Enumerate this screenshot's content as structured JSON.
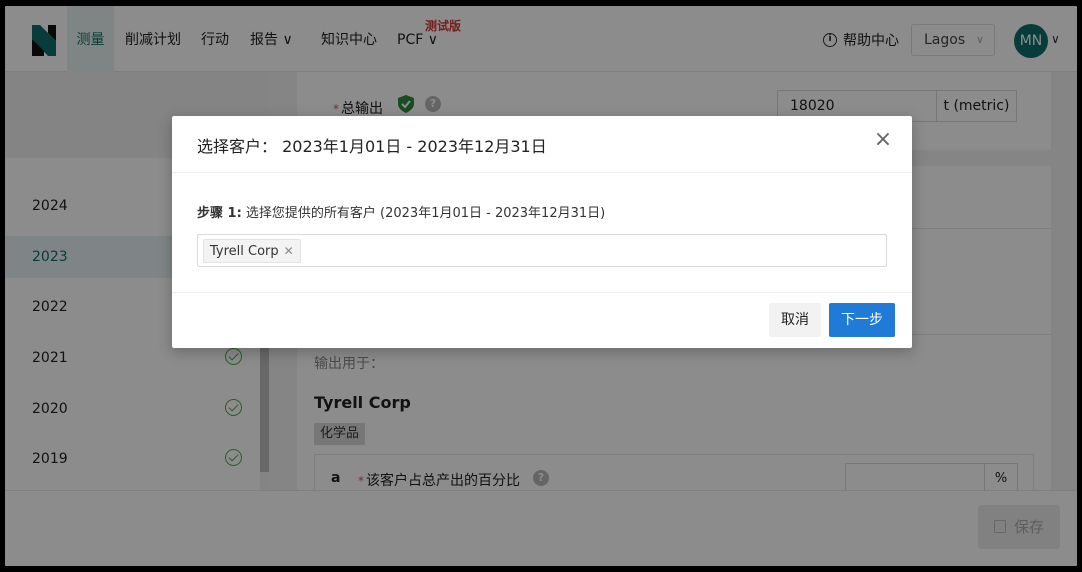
{
  "nav": {
    "items": [
      {
        "label": "测量",
        "active": true
      },
      {
        "label": "削减计划"
      },
      {
        "label": "行动"
      },
      {
        "label": "报告 ∨"
      },
      {
        "label": "知识中心"
      },
      {
        "label": "PCF ∨"
      }
    ],
    "beta_tag": "测试版",
    "help_label": "帮助中心",
    "location": "Lagos",
    "avatar_initials": "MN"
  },
  "sidebar": {
    "years": [
      {
        "label": "2024",
        "done": false
      },
      {
        "label": "2023",
        "done": false,
        "active": true
      },
      {
        "label": "2022",
        "done": false
      },
      {
        "label": "2021",
        "done": true
      },
      {
        "label": "2020",
        "done": true
      },
      {
        "label": "2019",
        "done": true
      }
    ]
  },
  "main": {
    "total_output_label": "总输出",
    "required_mark": "*",
    "total_output_value": "18020",
    "total_output_unit": "t (metric)",
    "output_for_label": "输出用于：",
    "customer_name": "Tyrell Corp",
    "customer_tag": "化学品",
    "sub_item_letter": "a",
    "sub_item_label": "该客户占总产出的百分比",
    "percent_unit": "%",
    "save_label": "保存"
  },
  "modal": {
    "title": "选择客户： 2023年1月01日 - 2023年12月31日",
    "step_prefix": "步骤 1:",
    "step_text": " 选择您提供的所有客户 (2023年1月01日 - 2023年12月31日)",
    "selected_chip": "Tyrell Corp",
    "cancel_label": "取消",
    "next_label": "下一步"
  },
  "colors": {
    "brand": "#0d6e6a",
    "primary_button": "#1f7bd6",
    "beta_red": "#d13b3b",
    "check_green": "#4caf50"
  }
}
